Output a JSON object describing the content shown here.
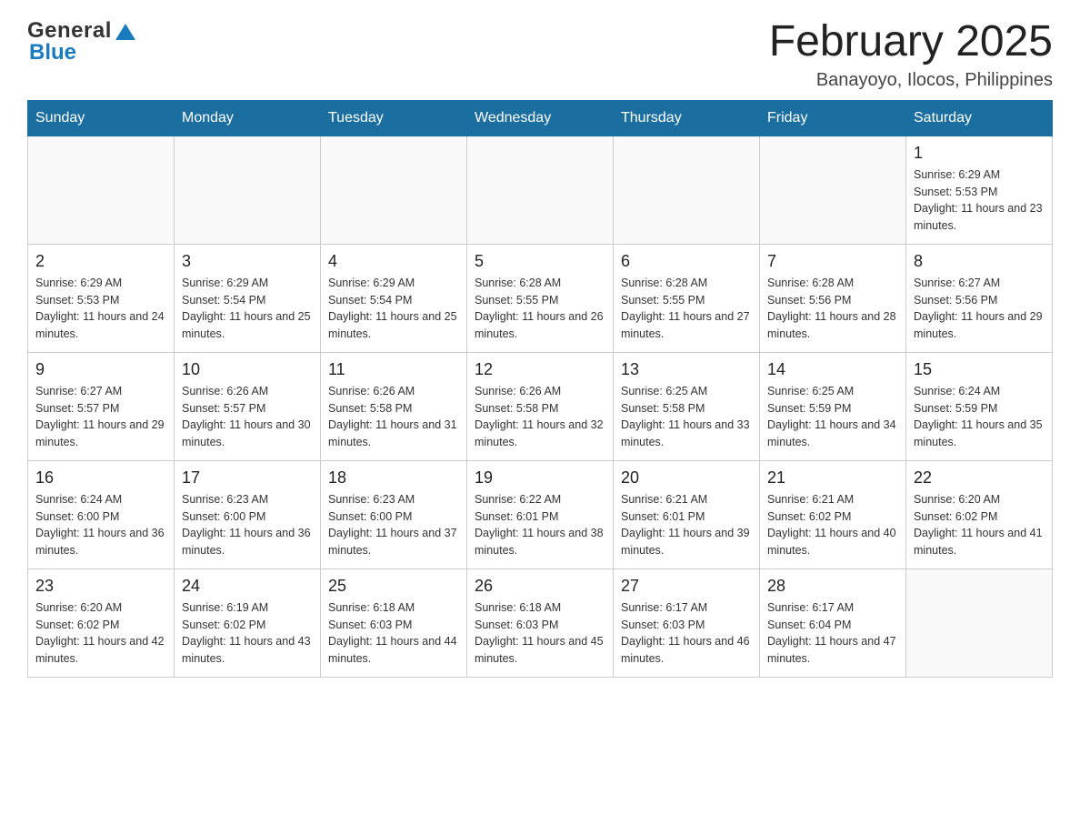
{
  "header": {
    "logo": {
      "general": "General",
      "triangle_color": "#1a7bbf",
      "blue": "Blue"
    },
    "title": "February 2025",
    "subtitle": "Banayoyo, Ilocos, Philippines"
  },
  "weekdays": [
    "Sunday",
    "Monday",
    "Tuesday",
    "Wednesday",
    "Thursday",
    "Friday",
    "Saturday"
  ],
  "weeks": [
    [
      {
        "day": "",
        "sunrise": "",
        "sunset": "",
        "daylight": ""
      },
      {
        "day": "",
        "sunrise": "",
        "sunset": "",
        "daylight": ""
      },
      {
        "day": "",
        "sunrise": "",
        "sunset": "",
        "daylight": ""
      },
      {
        "day": "",
        "sunrise": "",
        "sunset": "",
        "daylight": ""
      },
      {
        "day": "",
        "sunrise": "",
        "sunset": "",
        "daylight": ""
      },
      {
        "day": "",
        "sunrise": "",
        "sunset": "",
        "daylight": ""
      },
      {
        "day": "1",
        "sunrise": "Sunrise: 6:29 AM",
        "sunset": "Sunset: 5:53 PM",
        "daylight": "Daylight: 11 hours and 23 minutes."
      }
    ],
    [
      {
        "day": "2",
        "sunrise": "Sunrise: 6:29 AM",
        "sunset": "Sunset: 5:53 PM",
        "daylight": "Daylight: 11 hours and 24 minutes."
      },
      {
        "day": "3",
        "sunrise": "Sunrise: 6:29 AM",
        "sunset": "Sunset: 5:54 PM",
        "daylight": "Daylight: 11 hours and 25 minutes."
      },
      {
        "day": "4",
        "sunrise": "Sunrise: 6:29 AM",
        "sunset": "Sunset: 5:54 PM",
        "daylight": "Daylight: 11 hours and 25 minutes."
      },
      {
        "day": "5",
        "sunrise": "Sunrise: 6:28 AM",
        "sunset": "Sunset: 5:55 PM",
        "daylight": "Daylight: 11 hours and 26 minutes."
      },
      {
        "day": "6",
        "sunrise": "Sunrise: 6:28 AM",
        "sunset": "Sunset: 5:55 PM",
        "daylight": "Daylight: 11 hours and 27 minutes."
      },
      {
        "day": "7",
        "sunrise": "Sunrise: 6:28 AM",
        "sunset": "Sunset: 5:56 PM",
        "daylight": "Daylight: 11 hours and 28 minutes."
      },
      {
        "day": "8",
        "sunrise": "Sunrise: 6:27 AM",
        "sunset": "Sunset: 5:56 PM",
        "daylight": "Daylight: 11 hours and 29 minutes."
      }
    ],
    [
      {
        "day": "9",
        "sunrise": "Sunrise: 6:27 AM",
        "sunset": "Sunset: 5:57 PM",
        "daylight": "Daylight: 11 hours and 29 minutes."
      },
      {
        "day": "10",
        "sunrise": "Sunrise: 6:26 AM",
        "sunset": "Sunset: 5:57 PM",
        "daylight": "Daylight: 11 hours and 30 minutes."
      },
      {
        "day": "11",
        "sunrise": "Sunrise: 6:26 AM",
        "sunset": "Sunset: 5:58 PM",
        "daylight": "Daylight: 11 hours and 31 minutes."
      },
      {
        "day": "12",
        "sunrise": "Sunrise: 6:26 AM",
        "sunset": "Sunset: 5:58 PM",
        "daylight": "Daylight: 11 hours and 32 minutes."
      },
      {
        "day": "13",
        "sunrise": "Sunrise: 6:25 AM",
        "sunset": "Sunset: 5:58 PM",
        "daylight": "Daylight: 11 hours and 33 minutes."
      },
      {
        "day": "14",
        "sunrise": "Sunrise: 6:25 AM",
        "sunset": "Sunset: 5:59 PM",
        "daylight": "Daylight: 11 hours and 34 minutes."
      },
      {
        "day": "15",
        "sunrise": "Sunrise: 6:24 AM",
        "sunset": "Sunset: 5:59 PM",
        "daylight": "Daylight: 11 hours and 35 minutes."
      }
    ],
    [
      {
        "day": "16",
        "sunrise": "Sunrise: 6:24 AM",
        "sunset": "Sunset: 6:00 PM",
        "daylight": "Daylight: 11 hours and 36 minutes."
      },
      {
        "day": "17",
        "sunrise": "Sunrise: 6:23 AM",
        "sunset": "Sunset: 6:00 PM",
        "daylight": "Daylight: 11 hours and 36 minutes."
      },
      {
        "day": "18",
        "sunrise": "Sunrise: 6:23 AM",
        "sunset": "Sunset: 6:00 PM",
        "daylight": "Daylight: 11 hours and 37 minutes."
      },
      {
        "day": "19",
        "sunrise": "Sunrise: 6:22 AM",
        "sunset": "Sunset: 6:01 PM",
        "daylight": "Daylight: 11 hours and 38 minutes."
      },
      {
        "day": "20",
        "sunrise": "Sunrise: 6:21 AM",
        "sunset": "Sunset: 6:01 PM",
        "daylight": "Daylight: 11 hours and 39 minutes."
      },
      {
        "day": "21",
        "sunrise": "Sunrise: 6:21 AM",
        "sunset": "Sunset: 6:02 PM",
        "daylight": "Daylight: 11 hours and 40 minutes."
      },
      {
        "day": "22",
        "sunrise": "Sunrise: 6:20 AM",
        "sunset": "Sunset: 6:02 PM",
        "daylight": "Daylight: 11 hours and 41 minutes."
      }
    ],
    [
      {
        "day": "23",
        "sunrise": "Sunrise: 6:20 AM",
        "sunset": "Sunset: 6:02 PM",
        "daylight": "Daylight: 11 hours and 42 minutes."
      },
      {
        "day": "24",
        "sunrise": "Sunrise: 6:19 AM",
        "sunset": "Sunset: 6:02 PM",
        "daylight": "Daylight: 11 hours and 43 minutes."
      },
      {
        "day": "25",
        "sunrise": "Sunrise: 6:18 AM",
        "sunset": "Sunset: 6:03 PM",
        "daylight": "Daylight: 11 hours and 44 minutes."
      },
      {
        "day": "26",
        "sunrise": "Sunrise: 6:18 AM",
        "sunset": "Sunset: 6:03 PM",
        "daylight": "Daylight: 11 hours and 45 minutes."
      },
      {
        "day": "27",
        "sunrise": "Sunrise: 6:17 AM",
        "sunset": "Sunset: 6:03 PM",
        "daylight": "Daylight: 11 hours and 46 minutes."
      },
      {
        "day": "28",
        "sunrise": "Sunrise: 6:17 AM",
        "sunset": "Sunset: 6:04 PM",
        "daylight": "Daylight: 11 hours and 47 minutes."
      },
      {
        "day": "",
        "sunrise": "",
        "sunset": "",
        "daylight": ""
      }
    ]
  ]
}
